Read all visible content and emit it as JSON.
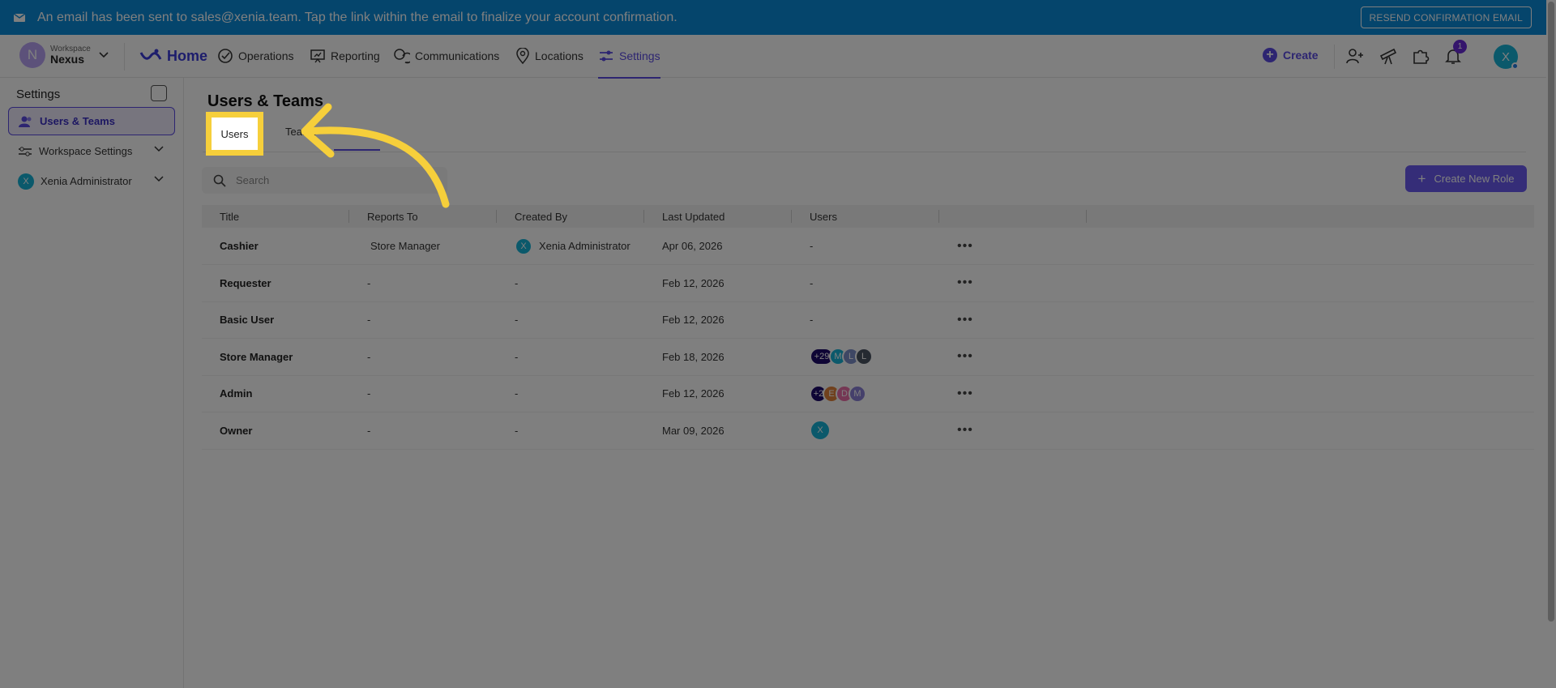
{
  "banner": {
    "message": "An email has been sent to sales@xenia.team. Tap the link within the email to finalize your account confirmation.",
    "resend_label": "RESEND CONFIRMATION EMAIL"
  },
  "workspace": {
    "label": "Workspace",
    "name": "Nexus",
    "initial": "N"
  },
  "nav": {
    "home": "Home",
    "operations": "Operations",
    "reporting": "Reporting",
    "communications": "Communications",
    "locations": "Locations",
    "settings": "Settings",
    "create": "Create",
    "notification_count": "1",
    "user_initial": "X"
  },
  "sidebar": {
    "title": "Settings",
    "items": [
      {
        "label": "Users & Teams"
      },
      {
        "label": "Workspace Settings"
      },
      {
        "label": "Xenia Administrator",
        "initial": "X"
      }
    ]
  },
  "main": {
    "title": "Users & Teams",
    "tabs": [
      {
        "label": "Users"
      },
      {
        "label": "Teams"
      }
    ],
    "search_placeholder": "Search",
    "create_role_label": "Create New Role",
    "columns": [
      "Title",
      "Reports To",
      "Created By",
      "Last Updated",
      "Users"
    ],
    "rows": [
      {
        "title": "Cashier",
        "reports_to": "Store Manager",
        "created_by": "Xenia Administrator",
        "created_by_initial": "X",
        "updated": "Apr 06, 2026",
        "users": "-"
      },
      {
        "title": "Requester",
        "reports_to": "-",
        "created_by": "-",
        "updated": "Feb 12, 2026",
        "users": "-"
      },
      {
        "title": "Basic User",
        "reports_to": "-",
        "created_by": "-",
        "updated": "Feb 12, 2026",
        "users": "-"
      },
      {
        "title": "Store Manager",
        "reports_to": "-",
        "created_by": "-",
        "updated": "Feb 18, 2026",
        "avatars": [
          "+29",
          "M",
          "L",
          "L"
        ]
      },
      {
        "title": "Admin",
        "reports_to": "-",
        "created_by": "-",
        "updated": "Feb 12, 2026",
        "avatars": [
          "+2",
          "E",
          "D",
          "M"
        ]
      },
      {
        "title": "Owner",
        "reports_to": "-",
        "created_by": "-",
        "updated": "Mar 09, 2026",
        "avatars": [
          "X"
        ]
      }
    ]
  },
  "colors": {
    "banner": "#0b8ad9",
    "accent": "#5a4be3",
    "highlight": "#f6cf3b"
  }
}
